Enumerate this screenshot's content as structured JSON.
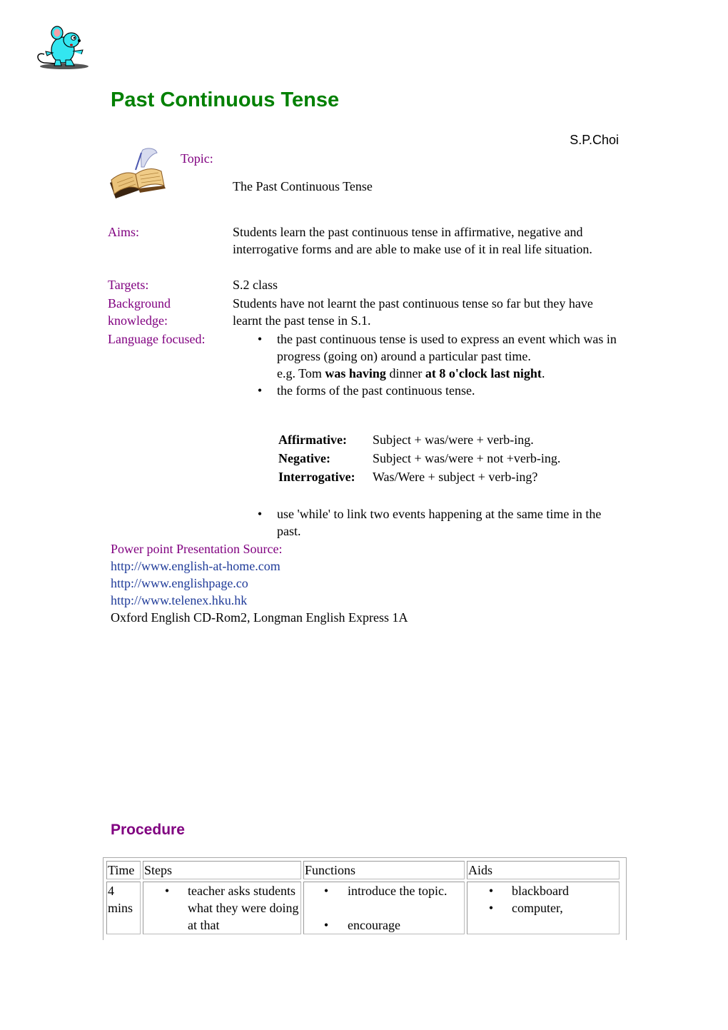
{
  "header": {
    "logo_icon": "cartoon-mouse-icon",
    "title": "Past Continuous Tense",
    "author": "S.P.Choi",
    "book_icon": "open-book-with-quill-icon"
  },
  "colors": {
    "title": "#008000",
    "label": "#800080",
    "link": "#1f3b99",
    "text": "#000000"
  },
  "topic": {
    "label": "Topic:",
    "value": "The Past Continuous Tense"
  },
  "details": {
    "aims": {
      "label": "Aims:",
      "value": "Students learn the past continuous tense in affirmative, negative and interrogative forms and are able to make use of it in real life situation."
    },
    "targets": {
      "label": "Targets:",
      "value": "S.2 class"
    },
    "background": {
      "label_line1": "Background",
      "label_line2": "knowledge:",
      "value": "Students have not learnt the past continuous tense so far but they have learnt the past tense in S.1."
    },
    "language_focused": {
      "label": "Language focused:",
      "bullet": "•",
      "point1": "the past continuous tense is used to express an event which was in progress (going on) around a particular past time.",
      "example": {
        "prefix": "e.g. Tom ",
        "bold1": "was having",
        "middle": " dinner ",
        "bold2": "at 8 o'clock last night",
        "suffix": "."
      },
      "point2": "the forms of the past continuous tense.",
      "forms": [
        {
          "label": "Affirmative:",
          "value": "Subject + was/were + verb-ing."
        },
        {
          "label": "Negative:",
          "value": "Subject + was/were + not +verb-ing."
        },
        {
          "label": "Interrogative:",
          "value": "Was/Were + subject + verb-ing?"
        }
      ],
      "point3": "use 'while' to link two events happening at the same time in the past."
    }
  },
  "sources": {
    "label": "Power point Presentation Source:",
    "links": [
      "http://www.english-at-home.com",
      "http://www.englishpage.co",
      "http://www.telenex.hku.hk"
    ],
    "other": "Oxford English CD-Rom2, Longman English Express 1A"
  },
  "procedure": {
    "title": "Procedure",
    "headers": [
      "Time",
      "Steps",
      "Functions",
      "Aids"
    ],
    "rows": [
      {
        "time_line1": "4",
        "time_line2": "mins",
        "steps": [
          "teacher asks students what they were doing at that"
        ],
        "functions": [
          "introduce the topic.",
          "encourage"
        ],
        "aids": [
          "blackboard",
          "computer,"
        ]
      }
    ]
  }
}
